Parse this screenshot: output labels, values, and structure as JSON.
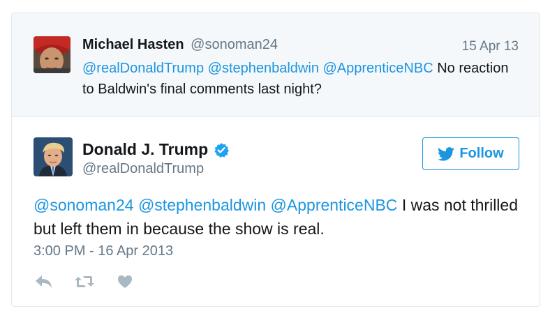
{
  "parent_tweet": {
    "author_name": "Michael Hasten",
    "author_handle": "@sonoman24",
    "date": "15 Apr 13",
    "mention1": "@realDonaldTrump",
    "mention2": "@stephenbaldwin",
    "mention3": "@ApprenticeNBC",
    "text_rest": "No reaction to Baldwin's final comments last night?"
  },
  "main_tweet": {
    "author_name": "Donald J. Trump",
    "author_handle": "@realDonaldTrump",
    "follow_label": "Follow",
    "mention1": "@sonoman24",
    "mention2": "@stephenbaldwin",
    "mention3": "@ApprenticeNBC",
    "text_rest": "I was not thrilled but left them in because the show is real.",
    "timestamp": "3:00 PM - 16 Apr 2013"
  },
  "icons": {
    "verified": "verified-badge-icon",
    "bird": "twitter-bird-icon",
    "reply": "reply-icon",
    "retweet": "retweet-icon",
    "like": "heart-icon"
  },
  "colors": {
    "link": "#1b95e0",
    "muted": "#657786",
    "parent_bg": "#f5f8fa",
    "border": "#e1e8ed",
    "action_icon": "#aab8c2"
  }
}
